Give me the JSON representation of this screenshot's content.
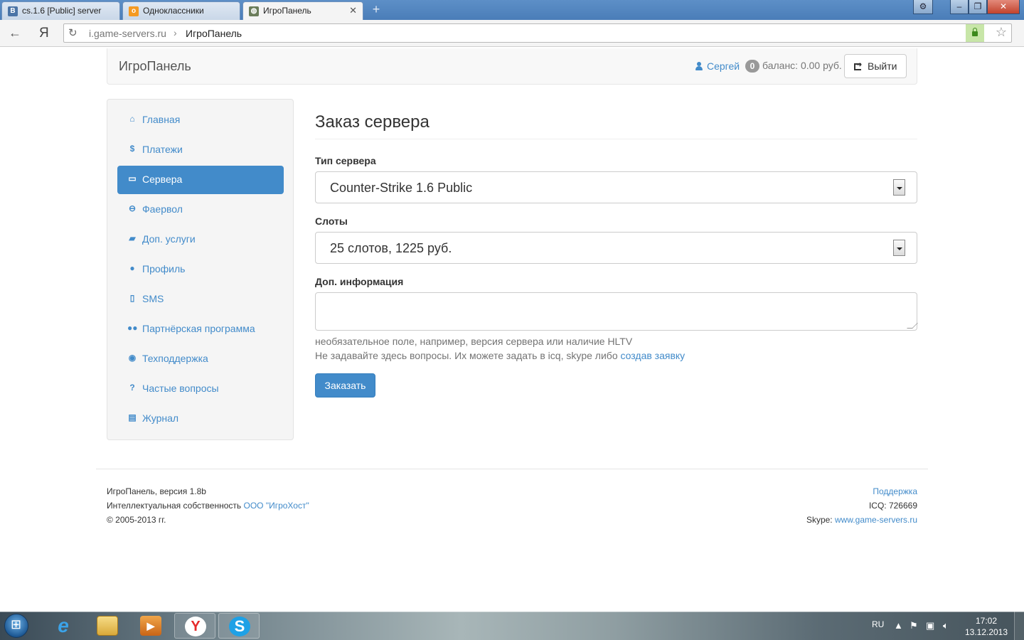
{
  "browser": {
    "tabs": [
      {
        "title": "cs.1.6 [Public] server",
        "favicon": "В",
        "favicon_color": "#4b74a6"
      },
      {
        "title": "Одноклассники",
        "favicon": "ok",
        "favicon_color": "#f59a22"
      },
      {
        "title": "ИгроПанель",
        "favicon": "ig",
        "favicon_color": "#6b7d5a"
      }
    ],
    "active_tab": 2,
    "address_domain": "i.game-servers.ru",
    "address_separator": "›",
    "address_page": "ИгроПанель",
    "yandex_logo": "Я"
  },
  "header": {
    "brand": "ИгроПанель",
    "user_name": "Сергей",
    "messages_count": "0",
    "balance": "баланс: 0.00 руб.",
    "logout_label": "Выйти"
  },
  "sidebar": {
    "active_index": 2,
    "items": [
      {
        "label": "Главная",
        "icon": "home-icon",
        "glyph": "⌂"
      },
      {
        "label": "Платежи",
        "icon": "dollar-icon",
        "glyph": "$"
      },
      {
        "label": "Сервера",
        "icon": "hdd-icon",
        "glyph": "▭"
      },
      {
        "label": "Фаервол",
        "icon": "minus-circle-icon",
        "glyph": "⊖"
      },
      {
        "label": "Доп. услуги",
        "icon": "folder-open-icon",
        "glyph": "▰"
      },
      {
        "label": "Профиль",
        "icon": "user-icon",
        "glyph": "●"
      },
      {
        "label": "SMS",
        "icon": "mobile-icon",
        "glyph": "▯"
      },
      {
        "label": "Партнёрская программа",
        "icon": "users-icon",
        "glyph": "●●"
      },
      {
        "label": "Техподдержка",
        "icon": "comments-icon",
        "glyph": "◉"
      },
      {
        "label": "Частые вопросы",
        "icon": "question-icon",
        "glyph": "?"
      },
      {
        "label": "Журнал",
        "icon": "archive-icon",
        "glyph": "▤"
      }
    ]
  },
  "form": {
    "title": "Заказ сервера",
    "server_type_label": "Тип сервера",
    "server_type_value": "Counter-Strike 1.6 Public",
    "slots_label": "Слоты",
    "slots_value": "25 слотов, 1225 руб.",
    "info_label": "Доп. информация",
    "info_value": "",
    "help_line1": "необязательное поле, например, версия сервера или наличие HLTV",
    "help_line2": "Не задавайте здесь вопросы. Их можете задать в icq, skype либо",
    "help_link": "создав заявку",
    "submit_label": "Заказать"
  },
  "footer": {
    "version": "ИгроПанель, версия 1.8b",
    "ip_prefix": "Интеллектуальная собственность",
    "ip_company": "ООО \"ИгроХост\"",
    "copyright": "© 2005-2013 гг.",
    "support_link": "Поддержка",
    "icq": "ICQ: 726669",
    "skype_prefix": "Skype:",
    "skype_link": "www.game-servers.ru"
  },
  "taskbar": {
    "apps": [
      "internet-explorer-icon",
      "file-explorer-icon",
      "media-player-icon",
      "yandex-browser-icon",
      "skype-icon"
    ],
    "language": "RU",
    "time": "17:02",
    "date": "13.12.2013"
  },
  "colors": {
    "accent": "#428bca",
    "active_item_bg": "#428bca",
    "muted_text": "#737373"
  }
}
